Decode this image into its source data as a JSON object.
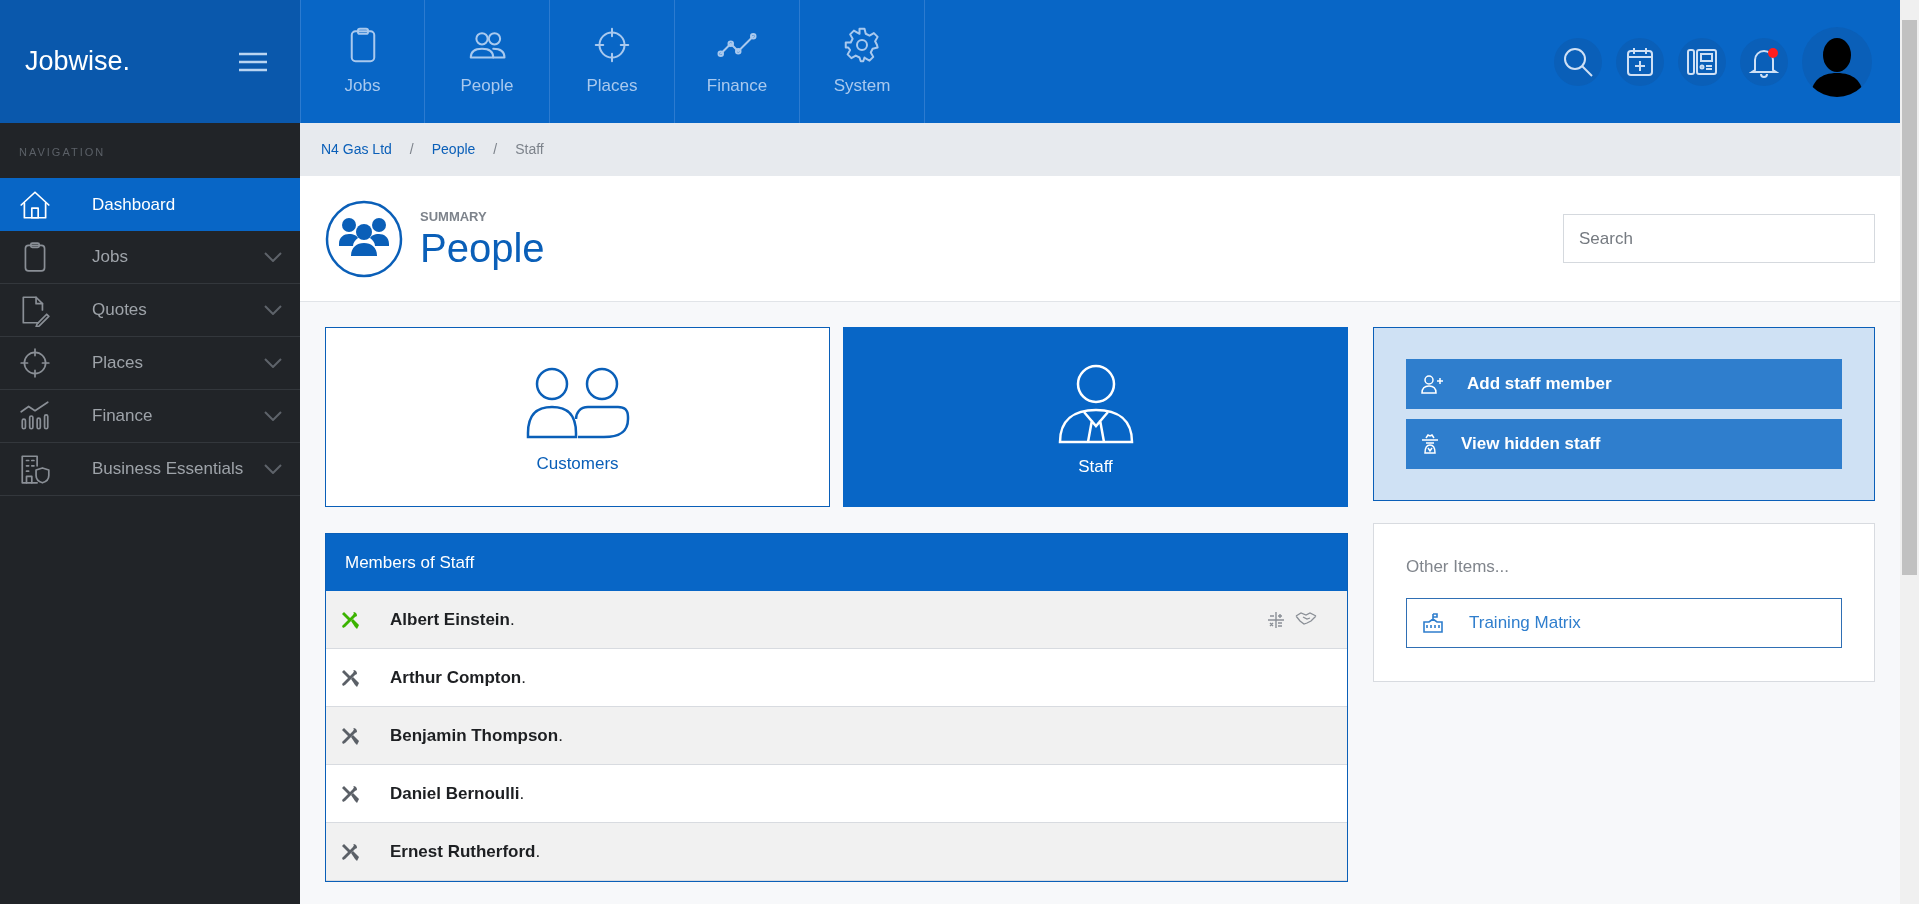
{
  "brand": "Jobwise.",
  "top_nav": [
    {
      "label": "Jobs"
    },
    {
      "label": "People"
    },
    {
      "label": "Places"
    },
    {
      "label": "Finance"
    },
    {
      "label": "System"
    }
  ],
  "toolbar": {
    "notifications_unread": true
  },
  "sidebar": {
    "heading": "NAVIGATION",
    "items": [
      {
        "label": "Dashboard",
        "selected": true,
        "expandable": false
      },
      {
        "label": "Jobs",
        "selected": false,
        "expandable": true
      },
      {
        "label": "Quotes",
        "selected": false,
        "expandable": true
      },
      {
        "label": "Places",
        "selected": false,
        "expandable": true
      },
      {
        "label": "Finance",
        "selected": false,
        "expandable": true
      },
      {
        "label": "Business Essentials",
        "selected": false,
        "expandable": true
      }
    ]
  },
  "breadcrumb": [
    {
      "label": "N4 Gas Ltd",
      "kind": "link"
    },
    {
      "label": "/",
      "kind": "separator"
    },
    {
      "label": "People",
      "kind": "link"
    },
    {
      "label": "/",
      "kind": "separator"
    },
    {
      "label": "Staff",
      "kind": "current"
    }
  ],
  "header": {
    "eyebrow": "SUMMARY",
    "title": "People",
    "search_placeholder": "Search"
  },
  "tiles": [
    {
      "label": "Customers",
      "kind": "customers",
      "selected": false
    },
    {
      "label": "Staff",
      "kind": "staff",
      "selected": true
    }
  ],
  "staff_panel": {
    "title": "Members of Staff",
    "rows": [
      {
        "name": "**Albert Einstein**.",
        "active": true,
        "actions": true
      },
      {
        "name": "**Arthur Compton**.",
        "active": false,
        "actions": false
      },
      {
        "name": "**Benjamin Thompson**.",
        "active": false,
        "actions": false
      },
      {
        "name": "**Daniel Bernoulli**.",
        "active": false,
        "actions": false
      },
      {
        "name": "**Ernest Rutherford**.",
        "active": false,
        "actions": false
      }
    ]
  },
  "actions": [
    {
      "label": "Add staff member"
    },
    {
      "label": "View hidden staff"
    }
  ],
  "other_items": {
    "title": "Other Items...",
    "links": [
      {
        "label": "Training Matrix"
      }
    ]
  }
}
